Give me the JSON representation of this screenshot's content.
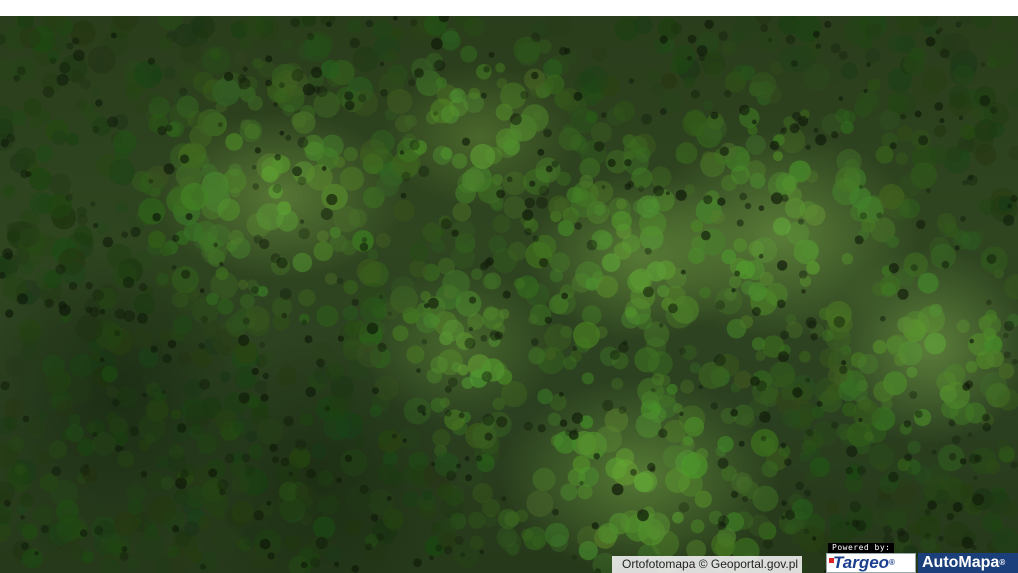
{
  "map": {
    "layer": "ortofotomapa",
    "attribution": "Ortofotomapa © Geoportal.gov.pl",
    "colors": {
      "canopy_dark": "#26391a",
      "canopy_mid": "#2f4520",
      "canopy_light": "#7aa84a"
    }
  },
  "branding": {
    "powered_by": "Powered by:",
    "targeo_name": "Targeo",
    "targeo_reg": "®",
    "automapa_name": "AutoMapa",
    "automapa_reg": "®"
  }
}
